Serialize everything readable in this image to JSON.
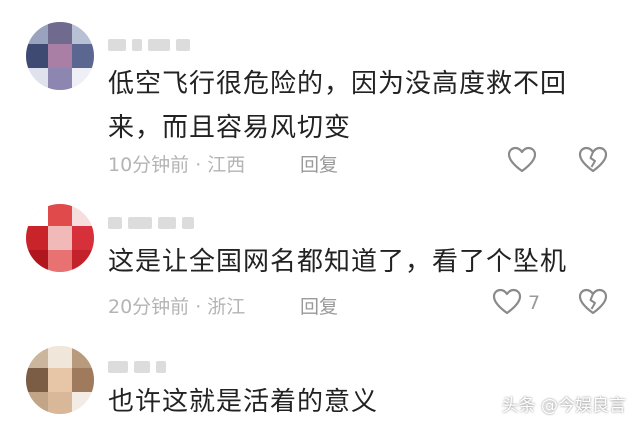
{
  "comments": [
    {
      "text_line1": "低空飞行很危险的，因为没高度救不回",
      "text_line2": "来，而且容易风切变",
      "time": "10分钟前",
      "location": "江西",
      "reply_label": "回复",
      "like_count": ""
    },
    {
      "text_line1": "这是让全国网名都知道了，看了个坠机",
      "text_line2": "",
      "time": "20分钟前",
      "location": "浙江",
      "reply_label": "回复",
      "like_count": "7"
    },
    {
      "text_line1": "也许这就是活着的意义",
      "text_line2": "",
      "time": "",
      "location": "",
      "reply_label": "",
      "like_count": ""
    }
  ],
  "meta_separator": "·",
  "watermark": "头条 @今娱良言",
  "icons": {
    "like": "heart-outline-icon",
    "dislike": "broken-heart-icon"
  },
  "colors": {
    "text": "#222222",
    "meta": "#b4b4b4",
    "icon": "#8a8a8a"
  }
}
